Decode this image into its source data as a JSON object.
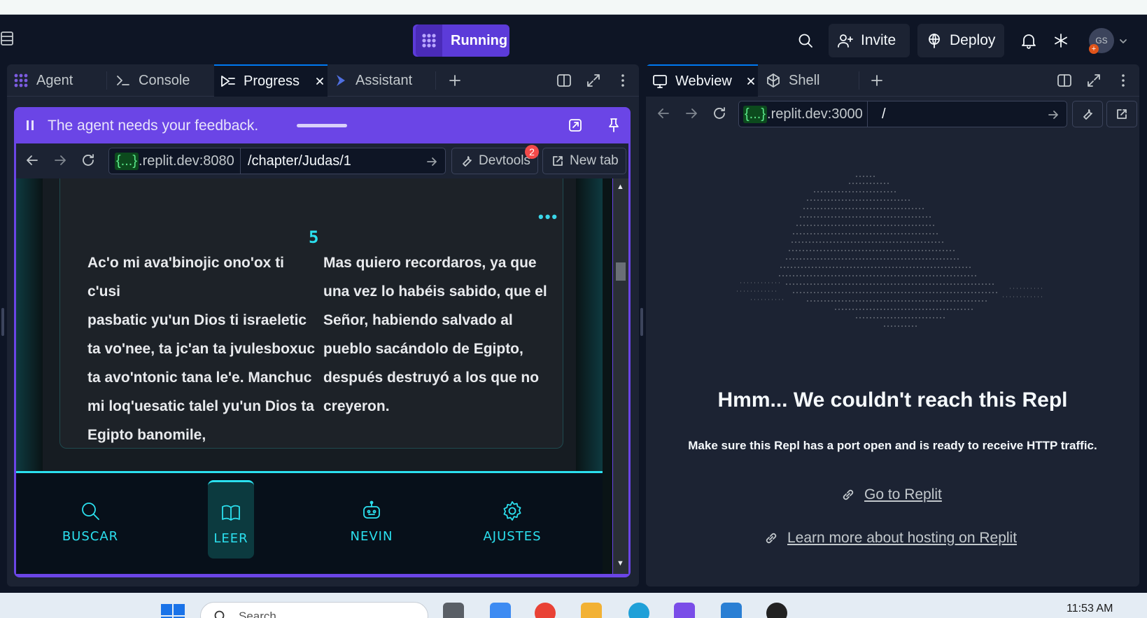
{
  "header": {
    "run_label": "Running",
    "invite_label": "Invite",
    "deploy_label": "Deploy",
    "avatar_initials": "GS"
  },
  "left_tabs": [
    {
      "label": "Agent"
    },
    {
      "label": "Console"
    },
    {
      "label": "Progress",
      "active": true
    },
    {
      "label": "Assistant"
    }
  ],
  "right_tabs": [
    {
      "label": "Webview",
      "active": true
    },
    {
      "label": "Shell"
    }
  ],
  "feedback": {
    "message": "The agent needs your feedback.",
    "host_tag": "{...}",
    "host": ".replit.dev:8080",
    "path": "/chapter/Judas/1",
    "devtools_label": "Devtools",
    "devtools_badge": "2",
    "newtab_label": "New tab"
  },
  "reader": {
    "verse_number": "5",
    "more_label": "•••",
    "left_lines": [
      "Ac'o mi ava'binojic ono'ox ti c'usi",
      "pasbatic yu'un Dios ti israeletic",
      "ta vo'nee, ta jc'an ta jvulesboxuc",
      "ta avo'ntonic tana le'e. Manchuc",
      "mi loq'uesatic talel yu'un Dios ta",
      "Egipto banomile,"
    ],
    "right_lines": [
      "Mas quiero recordaros, ya que",
      "una vez lo habéis sabido, que el",
      "Señor, habiendo salvado al",
      "pueblo sacándolo de Egipto,",
      "después destruyó a los que no",
      "creyeron."
    ],
    "nav": [
      {
        "label": "BUSCAR",
        "icon": "search-icon"
      },
      {
        "label": "LEER",
        "icon": "book-icon",
        "active": true
      },
      {
        "label": "NEVIN",
        "icon": "robot-icon"
      },
      {
        "label": "AJUSTES",
        "icon": "gear-icon"
      }
    ]
  },
  "webview": {
    "host_tag": "{...}",
    "host": ".replit.dev:3000",
    "path": "/",
    "error_title": "Hmm... We couldn't reach this Repl",
    "error_sub": "Make sure this Repl has a port open and is ready to receive HTTP traffic.",
    "link_replit": "Go to Replit",
    "link_hosting": "Learn more about hosting on Replit"
  },
  "taskbar": {
    "search_placeholder": "Search",
    "clock": "11:53 AM"
  },
  "colors": {
    "accent_purple": "#6b45e6",
    "run_purple": "#5c3bd9",
    "cyan": "#2be0ef",
    "bg": "#0e1525"
  }
}
